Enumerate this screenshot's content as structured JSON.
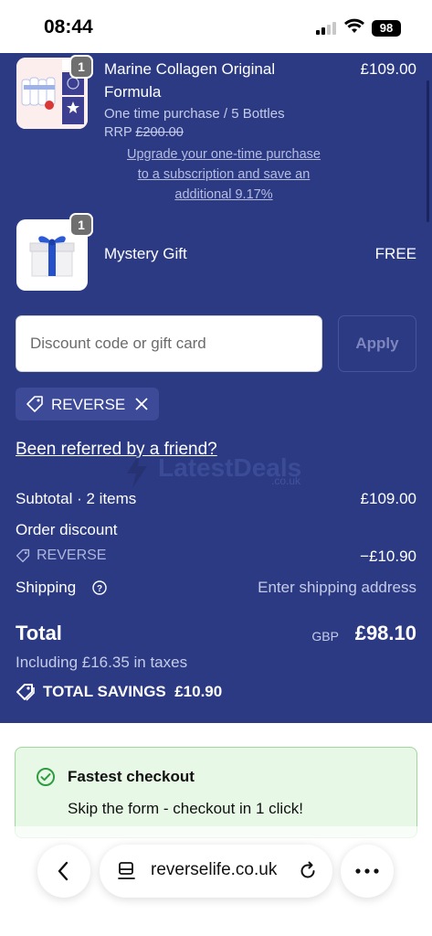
{
  "status_bar": {
    "time": "08:44",
    "battery": "98"
  },
  "cart": {
    "items": [
      {
        "name_line1": "Marine Collagen Original",
        "name_line2": "Formula",
        "variant": "One time purchase / 5 Bottles",
        "rrp_label": "RRP",
        "rrp_value": "£200.00",
        "price": "£109.00",
        "quantity": "1",
        "upgrade_line1": "Upgrade your one-time purchase",
        "upgrade_line2": "to a subscription and save an",
        "upgrade_line3": "additional 9.17%"
      },
      {
        "name": "Mystery Gift",
        "price": "FREE",
        "quantity": "1"
      }
    ]
  },
  "discount": {
    "placeholder": "Discount code or gift card",
    "apply_label": "Apply",
    "applied_code": "REVERSE"
  },
  "referral_link": "Been referred by a friend?",
  "watermark": {
    "name": "LatestDeals",
    "domain": ".co.uk"
  },
  "summary": {
    "subtotal_label": "Subtotal · 2 items",
    "subtotal_value": "£109.00",
    "order_discount_label": "Order discount",
    "discount_code": "REVERSE",
    "discount_value": "−£10.90",
    "shipping_label": "Shipping",
    "shipping_value": "Enter shipping address",
    "total_label": "Total",
    "currency": "GBP",
    "total_value": "£98.10",
    "taxes": "Including £16.35 in taxes",
    "savings_label": "TOTAL SAVINGS",
    "savings_value": "£10.90"
  },
  "fast_checkout": {
    "title": "Fastest checkout",
    "subtitle": "Skip the form - checkout in 1 click!"
  },
  "browser": {
    "url": "reverselife.co.uk"
  },
  "colors": {
    "summary_bg": "#2b3a83",
    "fast_checkout_bg": "#e7f8e6",
    "fast_checkout_border": "#9ed89a",
    "check_icon": "#2e9c3f"
  }
}
